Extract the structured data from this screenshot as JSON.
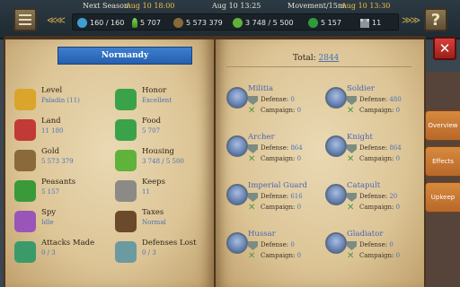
{
  "header": {
    "next_season_label": "Next Season:",
    "next_season_value": "Aug 10 18:00",
    "current_time": "Aug 10 13:25",
    "movement_label": "Movement/15m:",
    "movement_value": "Aug 10 13:30",
    "resources": {
      "population": "160 / 160",
      "food": "5 707",
      "gold": "5 573 379",
      "housing": "3 748 / 5 500",
      "peasants": "5 157",
      "keeps": "11"
    }
  },
  "realm": {
    "name": "Normandy",
    "stats": [
      {
        "name": "Level",
        "value": "Paladin (11)",
        "icon": "crown-icon",
        "color": "#d9a52a"
      },
      {
        "name": "Honor",
        "value": "Excellent",
        "icon": "honor-sparkle-icon",
        "color": "#3aa34a"
      },
      {
        "name": "Land",
        "value": "11 180",
        "icon": "land-flag-icon",
        "color": "#c23a38"
      },
      {
        "name": "Food",
        "value": "5 707",
        "icon": "sprout-icon",
        "color": "#3aa34a"
      },
      {
        "name": "Gold",
        "value": "5 573 379",
        "icon": "gold-bag-icon",
        "color": "#8a6a3a"
      },
      {
        "name": "Housing",
        "value": "3 748 / 5 500",
        "icon": "housing-icon",
        "color": "#5fb33a"
      },
      {
        "name": "Peasants",
        "value": "5 157",
        "icon": "peasant-hat-icon",
        "color": "#3a9a3a"
      },
      {
        "name": "Keeps",
        "value": "11",
        "icon": "keep-tower-icon",
        "color": "#8c8a86"
      },
      {
        "name": "Spy",
        "value": "Idle",
        "icon": "spy-icon",
        "color": "#9a55b8"
      },
      {
        "name": "Taxes",
        "value": "Normal",
        "icon": "taxes-bag-icon",
        "color": "#6a4a2a"
      },
      {
        "name": "Attacks Made",
        "value": "0 / 3",
        "icon": "crossed-swords-icon",
        "color": "#3a9a6a"
      },
      {
        "name": "Defenses Lost",
        "value": "0 / 3",
        "icon": "shield-icon",
        "color": "#6b9aa0"
      }
    ]
  },
  "army": {
    "total_label": "Total:",
    "total_value": "2844",
    "defense_label": "Defense:",
    "campaign_label": "Campaign:",
    "units": [
      {
        "name": "Militia",
        "defense": "0",
        "campaign": "0"
      },
      {
        "name": "Soldier",
        "defense": "480",
        "campaign": "0"
      },
      {
        "name": "Archer",
        "defense": "864",
        "campaign": "0"
      },
      {
        "name": "Knight",
        "defense": "864",
        "campaign": "0"
      },
      {
        "name": "Imperial Guard",
        "defense": "616",
        "campaign": "0"
      },
      {
        "name": "Catapult",
        "defense": "20",
        "campaign": "0"
      },
      {
        "name": "Hussar",
        "defense": "0",
        "campaign": "0"
      },
      {
        "name": "Gladiator",
        "defense": "0",
        "campaign": "0"
      }
    ]
  },
  "side_tabs": {
    "overview": "Overview",
    "effects": "Effects",
    "upkeep": "Upkeep"
  },
  "buttons": {
    "help": "?",
    "close": "✕"
  }
}
